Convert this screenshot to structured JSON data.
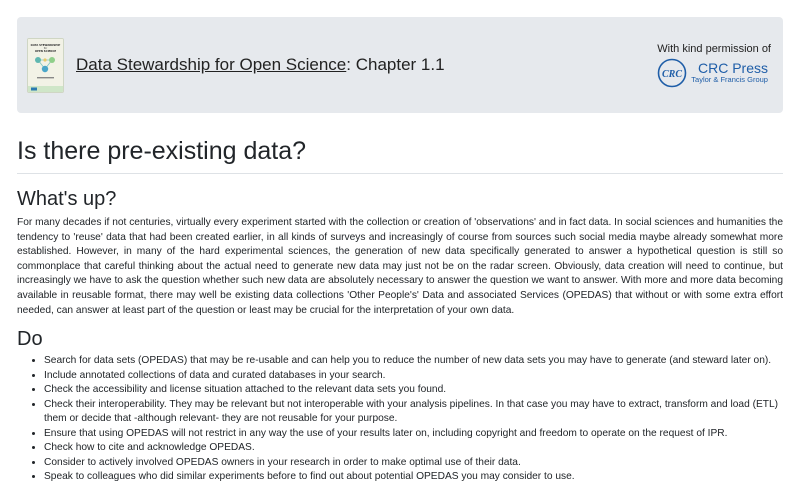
{
  "banner": {
    "book_title_link": "Data Stewardship for Open Science",
    "chapter_suffix": ": Chapter 1.1",
    "permission_text": "With kind permission of",
    "publisher_logo_mark": "CRC",
    "publisher_name": "CRC Press",
    "publisher_tagline": "Taylor & Francis Group",
    "cover_title_lines": [
      "DATA STEWARDSHIP",
      "for",
      "OPEN SCIENCE"
    ],
    "colors": {
      "banner_bg": "#e6e9ed",
      "publisher_blue": "#1f5ea8"
    }
  },
  "page_title": "Is there pre-existing data?",
  "whats_up": {
    "heading": "What's up?",
    "paragraph": "For many decades if not centuries, virtually every experiment started with the collection or creation of 'observations' and in fact data. In social sciences and humanities the tendency to 'reuse' data that had been created earlier, in all kinds of surveys and increasingly of course from sources such social media maybe already somewhat more established. However, in many of the hard experimental sciences, the generation of new data specifically generated to answer a hypothetical question is still so commonplace that careful thinking about the actual need to generate new data may just not be on the radar screen. Obviously, data creation will need to continue, but increasingly we have to ask the question whether such new data are absolutely necessary to answer the question we want to answer. With more and more data becoming available in reusable format, there may well be existing data collections 'Other People's' Data and associated Services (OPEDAS) that without or with some extra effort needed, can answer at least part of the question or least may be crucial for the interpretation of your own data."
  },
  "do_section": {
    "heading": "Do",
    "items": [
      "Search for data sets (OPEDAS) that may be re-usable and can help you to reduce the number of new data sets you may have to generate (and steward later on).",
      "Include annotated collections of data and curated databases in your search.",
      "Check the accessibility and license situation attached to the relevant data sets you found.",
      "Check their interoperability. They may be relevant but not interoperable with your analysis pipelines. In that case you may have to extract, transform and load (ETL) them or decide that -although relevant- they are not reusable for your purpose.",
      "Ensure that using OPEDAS will not restrict in any way the use of your results later on, including copyright and freedom to operate on the request of IPR.",
      "Check how to cite and acknowledge OPEDAS.",
      "Consider to actively involved OPEDAS owners in your research in order to make optimal use of their data.",
      "Speak to colleagues who did similar experiments before to find out about potential OPEDAS you may consider to use."
    ]
  }
}
